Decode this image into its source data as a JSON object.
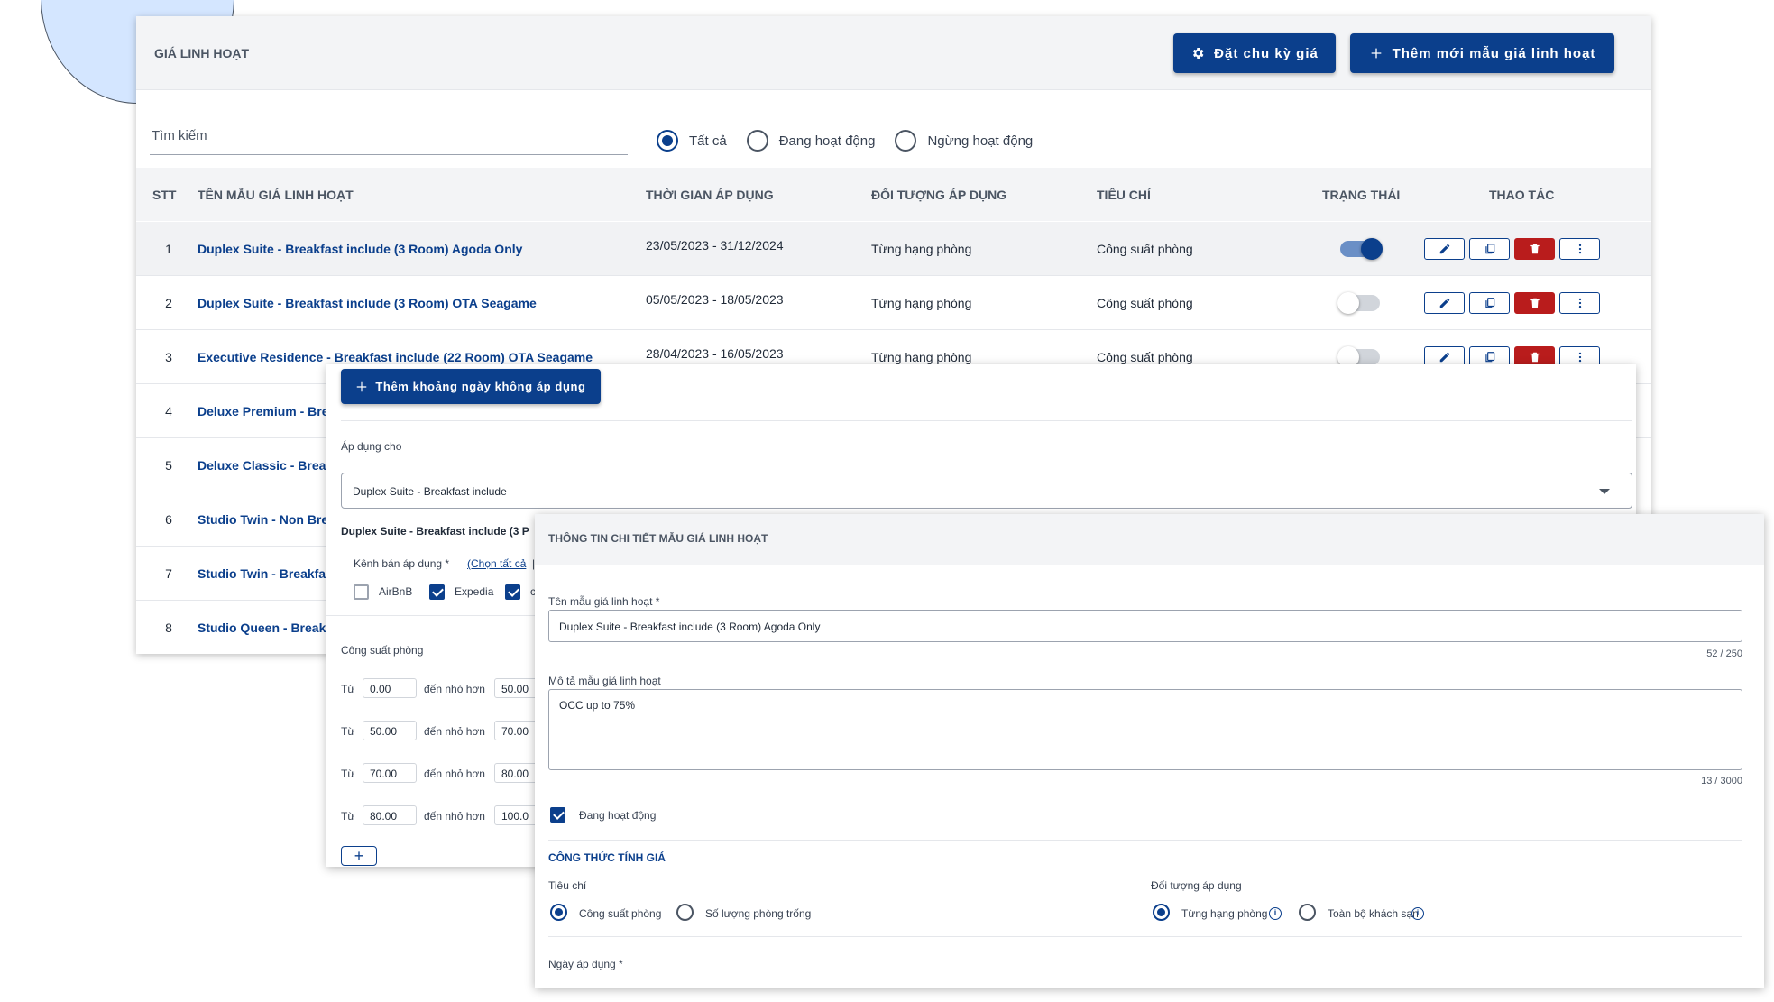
{
  "list": {
    "title": "GIÁ LINH HOẠT",
    "btn_cycle": "Đặt chu kỳ giá",
    "btn_add": "Thêm mới mẫu giá linh hoạt",
    "search_placeholder": "Tìm kiếm",
    "filters": [
      "Tất cả",
      "Đang hoạt động",
      "Ngừng hoạt động"
    ],
    "columns": {
      "stt": "STT",
      "name": "TÊN MẪU GIÁ LINH HOẠT",
      "time": "THỜI GIAN ÁP DỤNG",
      "object": "ĐỐI TƯỢNG ÁP DỤNG",
      "criteria": "TIÊU CHÍ",
      "status": "TRẠNG THÁI",
      "actions": "THAO TÁC"
    },
    "rows": [
      {
        "stt": "1",
        "name": "Duplex Suite - Breakfast include (3 Room) Agoda Only",
        "time": "23/05/2023 - 31/12/2024",
        "object": "Từng hạng phòng",
        "criteria": "Công suất phòng",
        "active": true
      },
      {
        "stt": "2",
        "name": "Duplex Suite - Breakfast include (3 Room) OTA Seagame",
        "time": "05/05/2023 - 18/05/2023",
        "object": "Từng hạng phòng",
        "criteria": "Công suất phòng",
        "active": false
      },
      {
        "stt": "3",
        "name": "Executive Residence - Breakfast include (22 Room) OTA Seagame",
        "time": "28/04/2023 - 16/05/2023",
        "object": "Từng hạng phòng",
        "criteria": "Công suất phòng",
        "active": false
      },
      {
        "stt": "4",
        "name": "Deluxe Premium - Bre"
      },
      {
        "stt": "5",
        "name": "Deluxe Classic - Breal"
      },
      {
        "stt": "6",
        "name": "Studio Twin - Non Bre"
      },
      {
        "stt": "7",
        "name": "Studio Twin - Breakfa"
      },
      {
        "stt": "8",
        "name": "Studio Queen - Breakf"
      }
    ]
  },
  "exclusion": {
    "btn_add_range": "Thêm khoảng ngày không áp dụng",
    "apply_for_label": "Áp dụng cho",
    "apply_for_value": "Duplex Suite - Breakfast include",
    "group_title": "Duplex Suite - Breakfast include (3 P",
    "channel_label": "Kênh bán áp dụng *",
    "select_all": "(Chọn tất cả",
    "select_all_tail": "|",
    "channels": [
      {
        "label": "AirBnB",
        "checked": false
      },
      {
        "label": "Expedia",
        "checked": true
      },
      {
        "label": "c",
        "checked": true
      }
    ],
    "capacity_label": "Công suất phòng",
    "from_label": "Từ",
    "to_label": "đến nhỏ hơn",
    "ranges": [
      {
        "from": "0.00",
        "to": "50.00"
      },
      {
        "from": "50.00",
        "to": "70.00"
      },
      {
        "from": "70.00",
        "to": "80.00"
      },
      {
        "from": "80.00",
        "to": "100.0"
      }
    ],
    "add_symbol": "+"
  },
  "detail": {
    "title": "THÔNG TIN CHI TIẾT MẪU GIÁ LINH HOẠT",
    "name_label": "Tên mẫu giá linh hoạt *",
    "name_value": "Duplex Suite - Breakfast include (3 Room) Agoda Only",
    "name_count": "52 / 250",
    "desc_label": "Mô tả mẫu giá linh hoạt",
    "desc_value": "OCC up to 75%",
    "desc_count": "13 / 3000",
    "active_label": "Đang hoạt động",
    "formula_title": "CÔNG THỨC TÍNH GIÁ",
    "criteria_label": "Tiêu chí",
    "criteria_opts": [
      "Công suất phòng",
      "Số lượng phòng trống"
    ],
    "object_label": "Đối tượng áp dụng",
    "object_opts": [
      "Từng hạng phòng",
      "Toàn bộ khách sạn"
    ],
    "date_label": "Ngày áp dụng *"
  },
  "colors": {
    "primary": "#0b3f8c",
    "danger": "#b91c1c",
    "accent_circle": "#d4e6ff"
  }
}
